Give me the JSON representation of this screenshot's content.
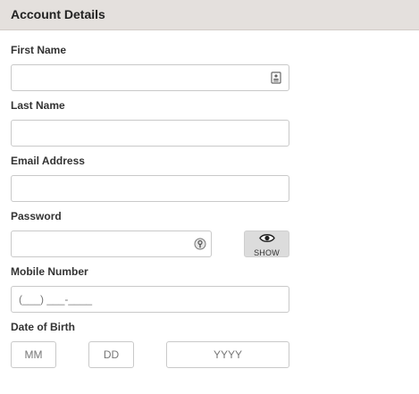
{
  "header": {
    "title": "Account Details"
  },
  "fields": {
    "first_name": {
      "label": "First Name",
      "value": "",
      "placeholder": ""
    },
    "last_name": {
      "label": "Last Name",
      "value": "",
      "placeholder": ""
    },
    "email": {
      "label": "Email Address",
      "value": "",
      "placeholder": ""
    },
    "password": {
      "label": "Password",
      "value": "",
      "placeholder": ""
    },
    "mobile": {
      "label": "Mobile Number",
      "value": "",
      "placeholder": "(___) ___-____"
    },
    "dob": {
      "label": "Date of Birth",
      "month_placeholder": "MM",
      "day_placeholder": "DD",
      "year_placeholder": "YYYY"
    }
  },
  "buttons": {
    "show_password_label": "SHOW"
  },
  "icons": {
    "contact_card": "contact-card-icon",
    "password_key": "password-key-icon",
    "eye": "eye-icon"
  }
}
